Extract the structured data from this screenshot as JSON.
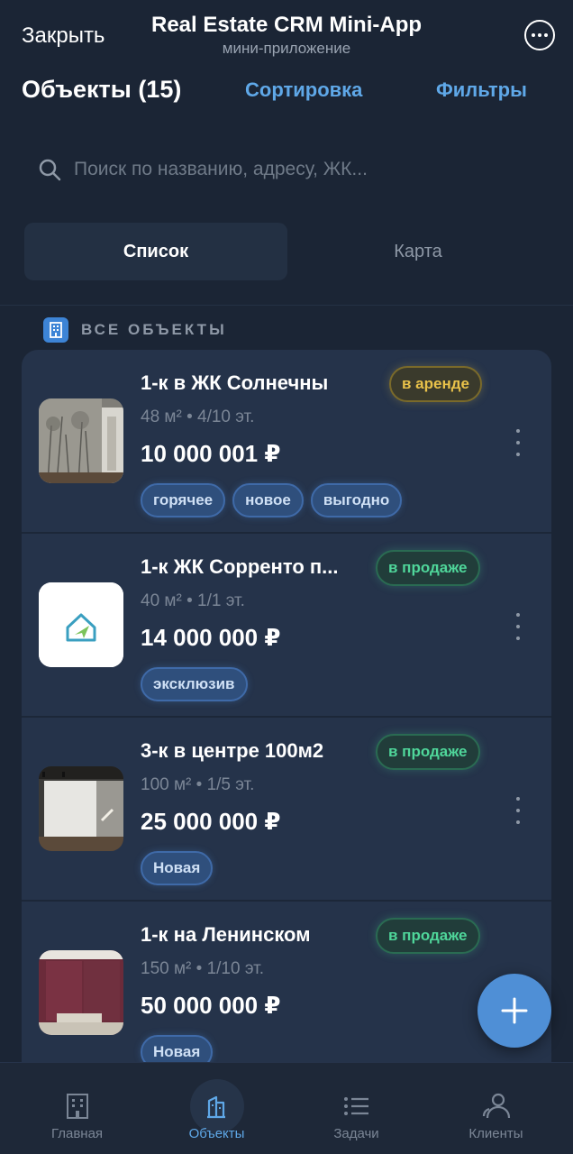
{
  "header": {
    "close_label": "Закрыть",
    "app_title": "Real Estate CRM Mini-App",
    "app_subtitle": "мини-приложение",
    "more_icon": "ellipsis-circle-icon"
  },
  "toolbar": {
    "title": "Объекты (15)",
    "sort_label": "Сортировка",
    "filter_label": "Фильтры"
  },
  "search": {
    "placeholder": "Поиск по названию, адресу, ЖК..."
  },
  "view_toggle": {
    "options": [
      "Список",
      "Карта"
    ],
    "selected": "Список"
  },
  "section": {
    "label": "ВСЕ ОБЪЕКТЫ",
    "icon": "building-icon"
  },
  "listings": [
    {
      "title": "1-к в ЖК Солнечны",
      "status": "в аренде",
      "meta": "48 м² • 4/10 эт.",
      "price": "10 000 001 ₽",
      "tags": [
        "горячее",
        "новое",
        "выгодно"
      ]
    },
    {
      "title": "1-к ЖК Сорренто п...",
      "status": "в продаже",
      "meta": "40 м² • 1/1 эт.",
      "price": "14 000 000 ₽",
      "tags": [
        "эксклюзив"
      ]
    },
    {
      "title": "3-к в центре 100м2",
      "status": "в продаже",
      "meta": "100 м² • 1/5 эт.",
      "price": "25 000 000 ₽",
      "tags": [
        "Новая"
      ]
    },
    {
      "title": "1-к на Ленинском",
      "status": "в продаже",
      "meta": "150 м² • 1/10 эт.",
      "price": "50 000 000 ₽",
      "tags": [
        "Новая"
      ]
    }
  ],
  "bottom_nav": [
    {
      "label": "Главная",
      "icon": "building-icon",
      "active": false
    },
    {
      "label": "Объекты",
      "icon": "buildings-icon",
      "active": true
    },
    {
      "label": "Задачи",
      "icon": "list-icon",
      "active": false
    },
    {
      "label": "Клиенты",
      "icon": "people-icon",
      "active": false
    }
  ],
  "colors": {
    "background": "#1b2535",
    "accent": "#5fa8e8",
    "rent_status": "#e9c24a",
    "sale_status": "#4fd69a"
  }
}
